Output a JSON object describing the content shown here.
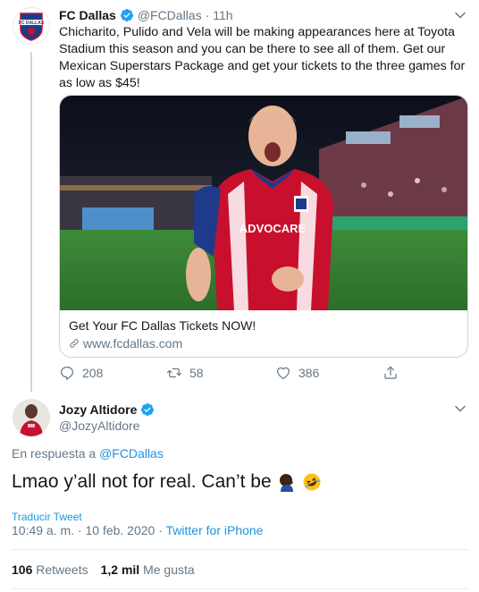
{
  "tweet1": {
    "name": "FC Dallas",
    "handle": "@FCDallas",
    "separator": "·",
    "time": "11h",
    "text": "Chicharito, Pulido and Vela will be making appearances here at Toyota Stadium this season and you can be there to see all of them. Get our Mexican Superstars Package and get your tickets to the three games for as low as $45!",
    "card": {
      "jersey_text": "ADVOCARE",
      "title": "Get Your FC Dallas Tickets NOW!",
      "url": "www.fcdallas.com"
    },
    "actions": {
      "replies": "208",
      "retweets": "58",
      "likes": "386"
    }
  },
  "tweet2": {
    "name": "Jozy Altidore",
    "handle": "@JozyAltidore",
    "reply_prefix": "En respuesta a ",
    "reply_to": "@FCDallas",
    "text": "Lmao y’all not for real. Can’t be",
    "translate": "Traducir Tweet",
    "timestamp": "10:49 a. m. · 10 feb. 2020 · ",
    "source": "Twitter for iPhone",
    "retweets_count": "106",
    "retweets_label": "Retweets",
    "likes_count": "1,2 mil",
    "likes_label": "Me gusta"
  },
  "colors": {
    "link_blue": "#1b95e0",
    "secondary_text": "#657786",
    "border": "#ccd6dd"
  }
}
